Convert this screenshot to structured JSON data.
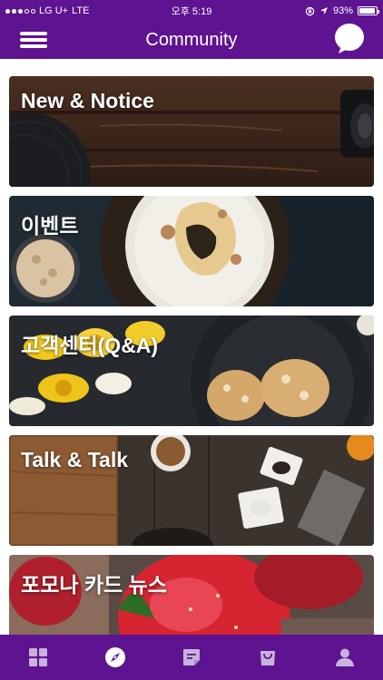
{
  "status_bar": {
    "carrier": "LG U+",
    "network": "LTE",
    "time": "오후 5:19",
    "battery": "93%",
    "battery_level": 0.93
  },
  "header": {
    "title": "Community",
    "menu_icon": "hamburger-menu-icon",
    "chat_icon": "chat-bubble-icon"
  },
  "cards": [
    {
      "label": "New & Notice"
    },
    {
      "label": "이벤트"
    },
    {
      "label": "고객센터(Q&A)"
    },
    {
      "label": "Talk & Talk"
    },
    {
      "label": "포모나 카드 뉴스"
    }
  ],
  "bottom_nav": {
    "items": [
      {
        "icon": "grid-icon"
      },
      {
        "icon": "compass-icon",
        "active": true
      },
      {
        "icon": "memo-icon"
      },
      {
        "icon": "shopping-bag-icon"
      },
      {
        "icon": "user-icon"
      }
    ]
  },
  "colors": {
    "brand": "#5e1490",
    "icon_inactive": "#c9b3dc",
    "icon_active": "#ffffff"
  }
}
